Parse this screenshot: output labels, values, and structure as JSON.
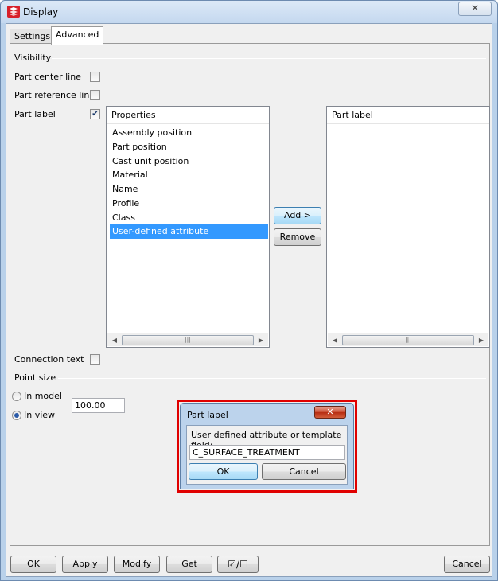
{
  "window": {
    "title": "Display",
    "close_glyph": "✕"
  },
  "tabs": [
    {
      "label": "Settings",
      "active": false
    },
    {
      "label": "Advanced",
      "active": true
    }
  ],
  "visibility": {
    "group_label": "Visibility",
    "part_center_line": {
      "label": "Part center line",
      "checked": false
    },
    "part_reference_line": {
      "label": "Part reference line",
      "checked": false
    },
    "part_label": {
      "label": "Part label",
      "checked": true
    }
  },
  "properties_list": {
    "header": "Properties",
    "items": [
      "Assembly position",
      "Part position",
      "Cast unit position",
      "Material",
      "Name",
      "Profile",
      "Class",
      "User-defined attribute"
    ],
    "selected_index": 7,
    "scroll_thumb_glyph": "|||"
  },
  "part_label_list": {
    "header": "Part label",
    "items": [],
    "scroll_thumb_glyph": "|||"
  },
  "transfer_buttons": {
    "add": "Add >",
    "remove": "Remove"
  },
  "connection_text": {
    "label": "Connection text",
    "checked": false
  },
  "point_size": {
    "group_label": "Point size",
    "in_model": {
      "label": "In model",
      "selected": false
    },
    "in_view": {
      "label": "In view",
      "selected": true
    },
    "value": "100.00"
  },
  "bottom_buttons": {
    "ok": "OK",
    "apply": "Apply",
    "modify": "Modify",
    "get": "Get",
    "toggle": "☑/☐",
    "cancel": "Cancel"
  },
  "popup": {
    "title": "Part label",
    "close_glyph": "✕",
    "prompt": "User defined attribute or template field:",
    "value": "C_SURFACE_TREATMENT",
    "ok": "OK",
    "cancel": "Cancel"
  },
  "colors": {
    "highlight": "#e00000",
    "selection": "#3399ff"
  }
}
